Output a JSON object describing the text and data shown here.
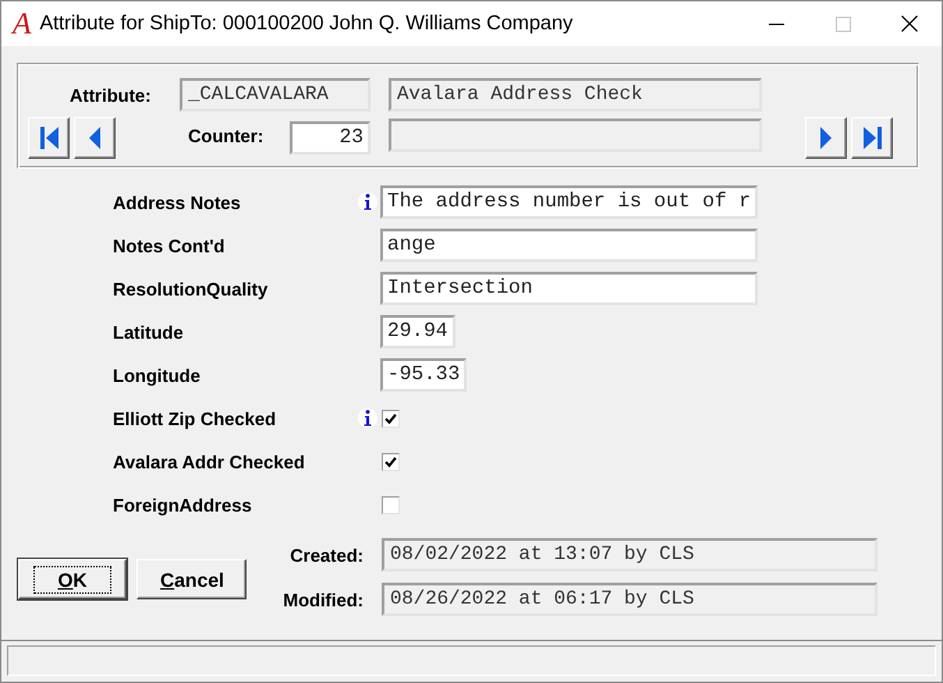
{
  "window": {
    "logo": "A",
    "title": "Attribute for ShipTo: 000100200 John Q. Williams Company",
    "maximize_disabled": true
  },
  "header": {
    "attribute_label": "Attribute:",
    "attribute_code": "_CALCAVALARA",
    "attribute_description": "Avalara Address Check",
    "counter_label": "Counter:",
    "counter": "23"
  },
  "fields": [
    {
      "kind": "text",
      "label": "Address Notes",
      "info": true,
      "value": "The address number is out of r"
    },
    {
      "kind": "text",
      "label": "Notes Cont'd",
      "info": false,
      "value": "ange"
    },
    {
      "kind": "text",
      "label": "ResolutionQuality",
      "info": false,
      "value": "Intersection"
    },
    {
      "kind": "number",
      "label": "Latitude",
      "info": false,
      "value": "29.94"
    },
    {
      "kind": "number",
      "label": "Longitude",
      "info": false,
      "value": "-95.33"
    },
    {
      "kind": "checkbox",
      "label": "Elliott Zip Checked",
      "info": true,
      "checked": true
    },
    {
      "kind": "checkbox",
      "label": "Avalara Addr Checked",
      "info": false,
      "checked": true
    },
    {
      "kind": "checkbox",
      "label": "ForeignAddress",
      "info": false,
      "checked": false
    }
  ],
  "buttons": [
    {
      "label": "OK",
      "default": true
    },
    {
      "label": "Cancel",
      "default": false
    }
  ],
  "audit": [
    {
      "label": "Created:",
      "value": "08/02/2022 at 13:07 by CLS"
    },
    {
      "label": "Modified:",
      "value": "08/26/2022 at 06:17 by CLS"
    }
  ]
}
